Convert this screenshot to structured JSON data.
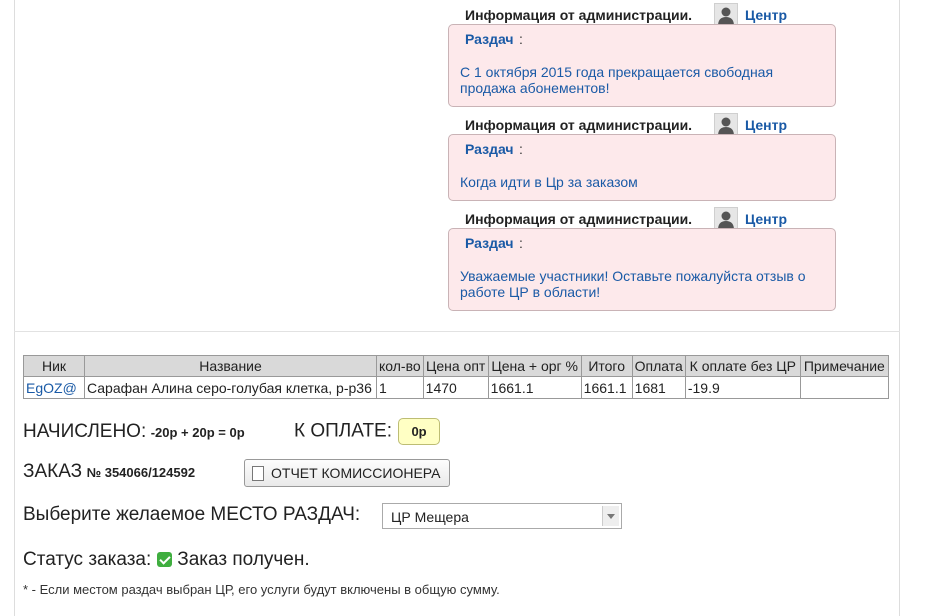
{
  "notices": [
    {
      "from": "Информация от администрации.",
      "author": "Центр",
      "topic": "Раздач",
      "colon": ":",
      "message": "С 1 октября 2015 года прекращается свободная продажа абонементов!"
    },
    {
      "from": "Информация от администрации.",
      "author": "Центр",
      "topic": "Раздач",
      "colon": ":",
      "message": "Когда идти в Цр за заказом"
    },
    {
      "from": "Информация от администрации.",
      "author": "Центр",
      "topic": "Раздач",
      "colon": ":",
      "message": "Уважаемые участники! Оставьте пожалуйста отзыв о работе ЦР в области!"
    }
  ],
  "table": {
    "headers": [
      "Ник",
      "Название",
      "кол-во",
      "Цена опт",
      "Цена + орг %",
      "Итого",
      "Оплата",
      "К оплате без ЦР",
      "Примечание"
    ],
    "rows": [
      [
        "EgOZ@",
        "Сарафан Алина серо-голубая клетка, р-р36",
        "1",
        "1470",
        "1661.1",
        "1661.1",
        "1681",
        "-19.9",
        ""
      ]
    ]
  },
  "summary": {
    "accrued_label": "НАЧИСЛЕНО:",
    "accrued_value": "-20р + 20р = 0р",
    "to_pay_label": "К ОПЛАТЕ:",
    "to_pay_value": "0р",
    "order_label": "ЗАКАЗ",
    "order_number": "№ 354066/124592",
    "report_button": "ОТЧЕТ КОМИССИОНЕРА",
    "pickup_label": "Выберите желаемое МЕСТО РАЗДАЧ:",
    "pickup_selected": "ЦР Мещера",
    "status_label": "Статус заказа:",
    "status_value": "Заказ получен.",
    "footnote": "* - Если местом раздач выбран ЦР, его услуги будут включены в общую сумму."
  },
  "colors": {
    "link": "#1a5aa6",
    "notice_bg": "#fde9eb",
    "badge_bg": "#ffffc4",
    "status_green": "#3fae3f"
  }
}
